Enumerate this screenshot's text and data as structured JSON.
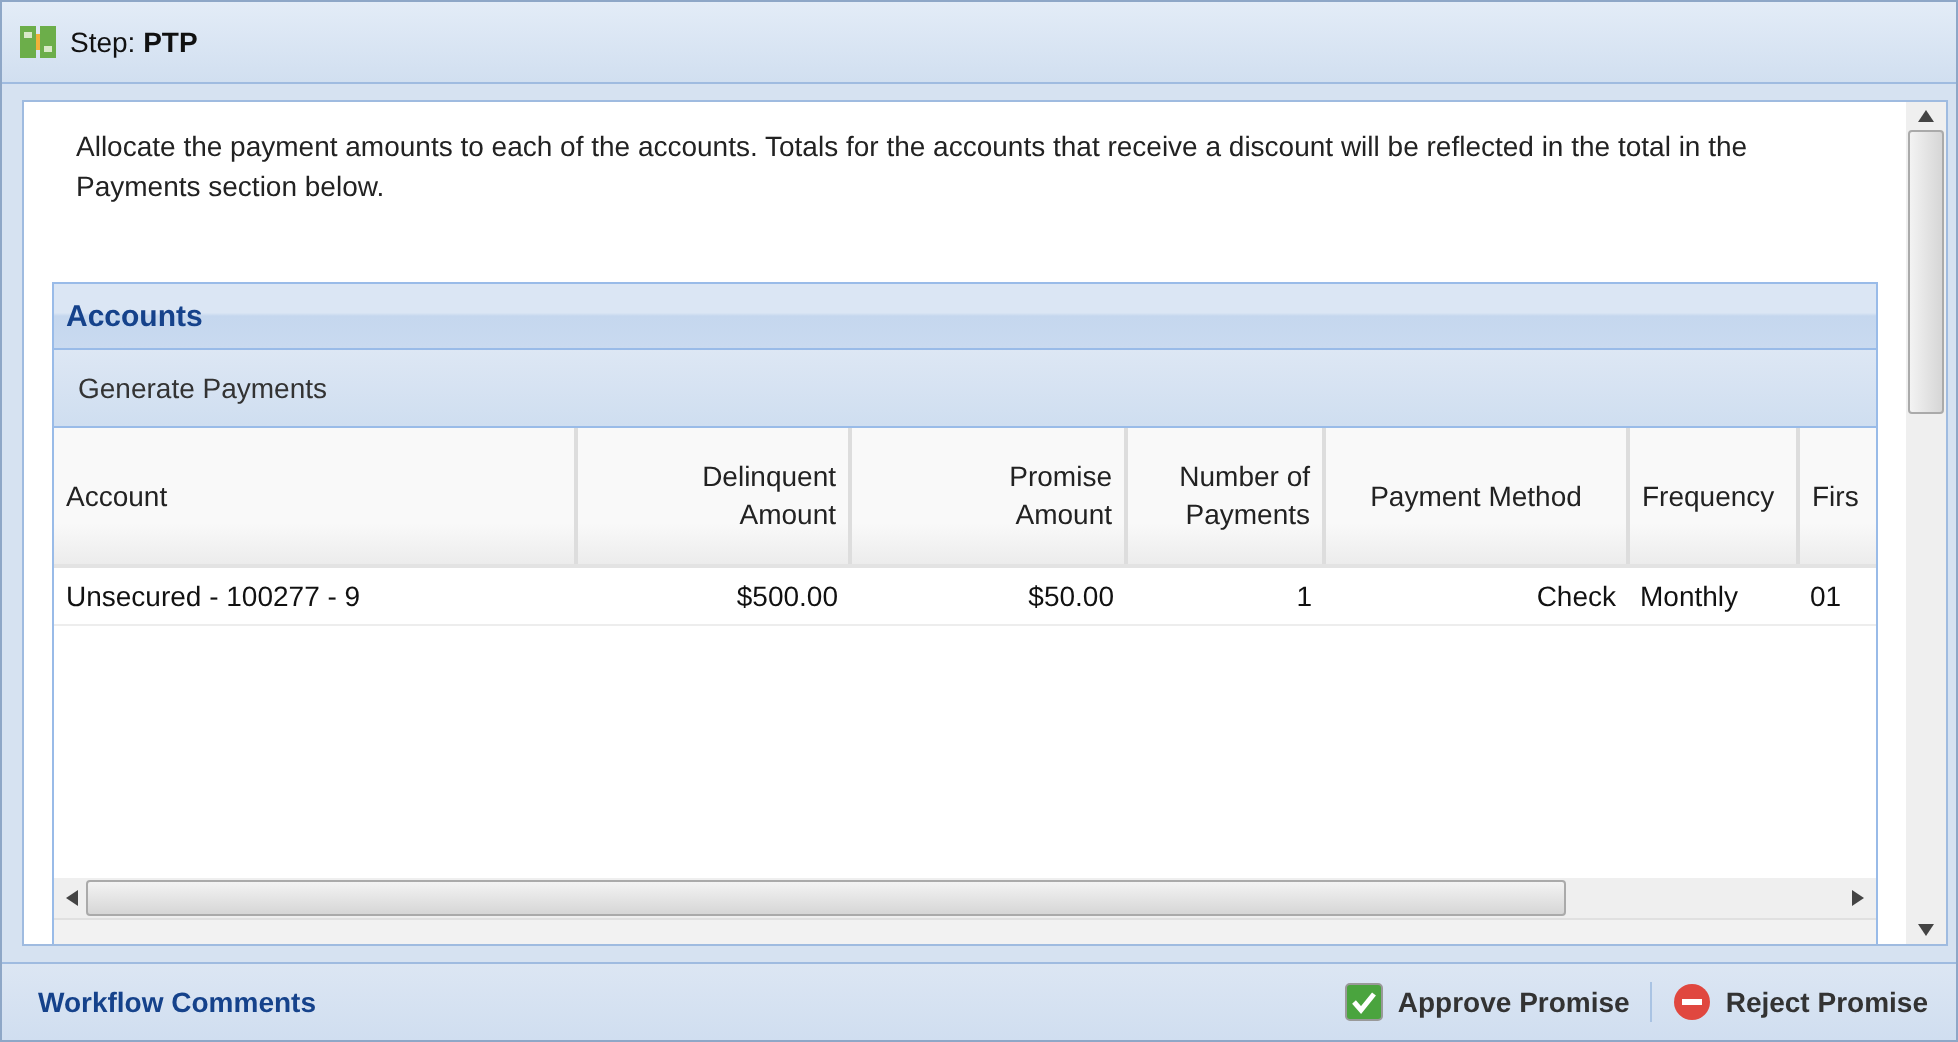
{
  "header": {
    "title": "Step: **PTP**"
  },
  "instructions": "Allocate the payment amounts to each of the accounts. Totals for the accounts that receive a discount will be reflected in the total in the Payments section below.",
  "accounts": {
    "title": "Accounts",
    "toolbar_button": "Generate Payments",
    "columns": [
      "Account",
      "Delinquent Amount",
      "Promise Amount",
      "Number of Payments",
      "Payment Method",
      "Frequency",
      "Firs"
    ],
    "rows": [
      [
        "Unsecured - 100277 - 9",
        "$500.00",
        "$50.00",
        "1",
        "Check",
        "Monthly",
        "01"
      ]
    ]
  },
  "footer": {
    "title": "Workflow Comments",
    "actions": [
      {
        "label": "Approve Promise",
        "kind": "approve"
      },
      {
        "label": "Reject Promise",
        "kind": "reject"
      }
    ]
  }
}
